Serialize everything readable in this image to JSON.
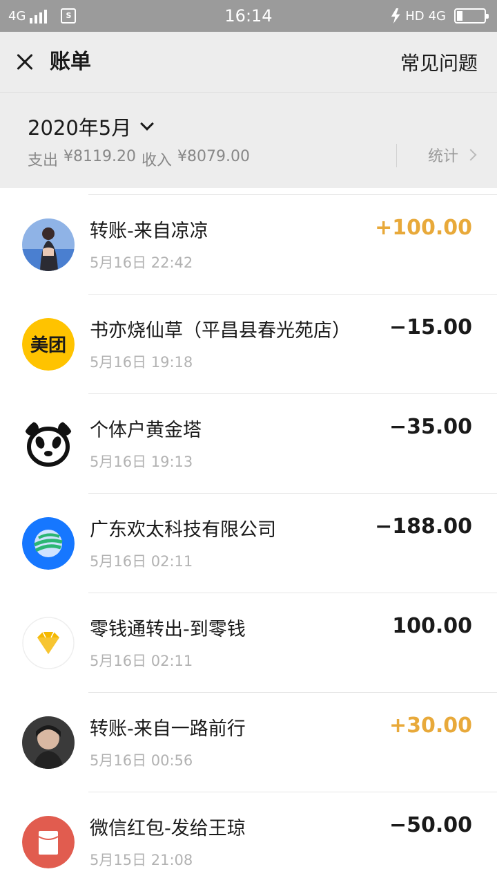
{
  "status_bar": {
    "network": "4G",
    "sim_label": "S",
    "time": "16:14",
    "hd_label": "HD",
    "network_right": "4G"
  },
  "header": {
    "title": "账单",
    "faq_label": "常见问题"
  },
  "summary": {
    "month": "2020年5月",
    "expense_label": "支出",
    "expense_value": "¥8119.20",
    "income_label": "收入",
    "income_value": "¥8079.00",
    "stats_label": "统计"
  },
  "transactions": [
    {
      "name": "转账-来自凉凉",
      "time": "5月16日 22:42",
      "amount": "+100.00",
      "type": "income",
      "icon": "user-photo-avatar"
    },
    {
      "name": "书亦烧仙草（平昌县春光苑店）",
      "time": "5月16日 19:18",
      "amount": "−15.00",
      "type": "expense",
      "icon": "meituan-logo",
      "icon_text": "美团"
    },
    {
      "name": "个体户黄金塔",
      "time": "5月16日 19:13",
      "amount": "−35.00",
      "type": "expense",
      "icon": "panda-avatar"
    },
    {
      "name": "广东欢太科技有限公司",
      "time": "5月16日 02:11",
      "amount": "−188.00",
      "type": "expense",
      "icon": "company-logo"
    },
    {
      "name": "零钱通转出-到零钱",
      "time": "5月16日 02:11",
      "amount": "100.00",
      "type": "neutral",
      "icon": "diamond-icon"
    },
    {
      "name": "转账-来自一路前行",
      "time": "5月16日 00:56",
      "amount": "+30.00",
      "type": "income",
      "icon": "user-photo-avatar"
    },
    {
      "name": "微信红包-发给王琼",
      "time": "5月15日 21:08",
      "amount": "−50.00",
      "type": "expense",
      "icon": "red-packet-icon"
    }
  ],
  "colors": {
    "income": "#e8a93a",
    "header_bg": "#ededed",
    "meituan": "#ffc300",
    "red_packet": "#e15c4f",
    "company": "#1677ff"
  }
}
